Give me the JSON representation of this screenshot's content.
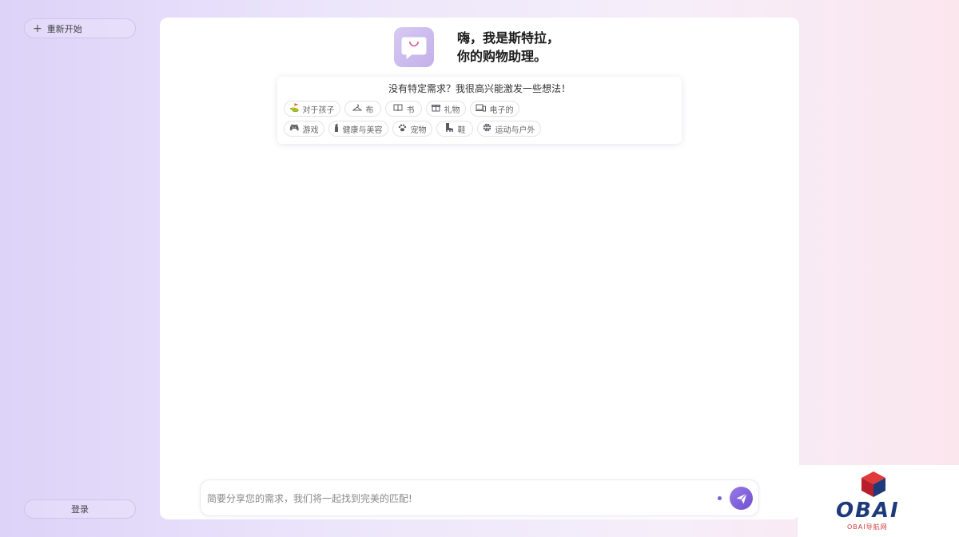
{
  "sidebar": {
    "new_chat_label": "重新开始",
    "login_label": "登录"
  },
  "header": {
    "greeting_line1": "嗨，我是斯特拉，",
    "greeting_line2": "你的购物助理。"
  },
  "suggestions": {
    "title": "没有特定需求？我很高兴能激发一些想法！",
    "row1": [
      {
        "label": "对于孩子",
        "icon": "baby-carriage-icon"
      },
      {
        "label": "布",
        "icon": "hanger-icon"
      },
      {
        "label": "书",
        "icon": "book-icon"
      },
      {
        "label": "礼物",
        "icon": "gift-icon"
      },
      {
        "label": "电子的",
        "icon": "devices-icon"
      }
    ],
    "row2": [
      {
        "label": "游戏",
        "icon": "gamepad-icon"
      },
      {
        "label": "健康与美容",
        "icon": "lipstick-icon"
      },
      {
        "label": "宠物",
        "icon": "paw-icon"
      },
      {
        "label": "鞋",
        "icon": "boot-icon"
      },
      {
        "label": "运动与户外",
        "icon": "basketball-icon"
      }
    ]
  },
  "input": {
    "placeholder": "简要分享您的需求，我们将一起找到完美的匹配!",
    "value": ""
  },
  "watermark": {
    "brand": "OBAI",
    "subtitle": "OBAI导航网"
  },
  "colors": {
    "accent": "#7b5fd0",
    "logo_bg": "#c3b0ea"
  }
}
